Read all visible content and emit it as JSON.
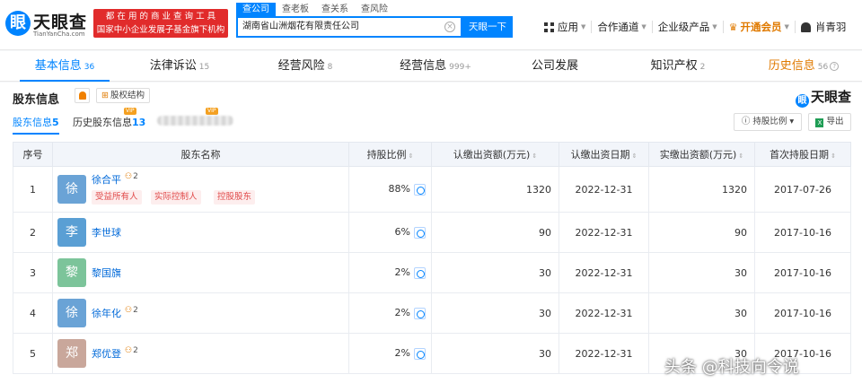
{
  "logo": {
    "brand": "天眼查",
    "domain": "TianYanCha.com",
    "mark": "眼"
  },
  "slogan": {
    "line1": "都 在 用 的 商 业 查 询 工 具",
    "line2": "国家中小企业发展子基金旗下机构"
  },
  "search": {
    "tabs": [
      "查公司",
      "查老板",
      "查关系",
      "查风险"
    ],
    "value": "湖南省山洲烟花有限责任公司",
    "button": "天眼一下"
  },
  "nav": {
    "app": "应用",
    "partner": "合作通道",
    "enterprise": "企业级产品",
    "vip": "开通会员",
    "user": "肖青羽"
  },
  "tabs": [
    {
      "label": "基本信息",
      "count": "36"
    },
    {
      "label": "法律诉讼",
      "count": "15"
    },
    {
      "label": "经营风险",
      "count": "8"
    },
    {
      "label": "经营信息",
      "count": "999+"
    },
    {
      "label": "公司发展",
      "count": ""
    },
    {
      "label": "知识产权",
      "count": "2"
    },
    {
      "label": "历史信息",
      "count": "56"
    }
  ],
  "section": {
    "title": "股东信息",
    "structure_btn": "股权结构",
    "watermark": "天眼查",
    "subtab_current": "股东信息",
    "subtab_current_count": "5",
    "subtab_history": "历史股东信息",
    "subtab_history_count": "13",
    "badge": "VIP",
    "ratio_btn": "持股比例",
    "export_btn": "导出"
  },
  "table": {
    "headers": [
      "序号",
      "股东名称",
      "持股比例",
      "认缴出资额(万元)",
      "认缴出资日期",
      "实缴出资额(万元)",
      "首次持股日期"
    ],
    "rows": [
      {
        "idx": "1",
        "avatar": "徐",
        "color": "#6aa3d6",
        "name": "徐合平",
        "count": "2",
        "ratio": "88%",
        "subscribed": "1320",
        "sub_date": "2022-12-31",
        "paid": "1320",
        "first_date": "2017-07-26",
        "tags": [
          "受益所有人",
          "实际控制人",
          "控股股东"
        ]
      },
      {
        "idx": "2",
        "avatar": "李",
        "color": "#5a9fd4",
        "name": "李世球",
        "count": "",
        "ratio": "6%",
        "subscribed": "90",
        "sub_date": "2022-12-31",
        "paid": "90",
        "first_date": "2017-10-16",
        "tags": []
      },
      {
        "idx": "3",
        "avatar": "黎",
        "color": "#7cc49a",
        "name": "黎国旗",
        "count": "",
        "ratio": "2%",
        "subscribed": "30",
        "sub_date": "2022-12-31",
        "paid": "30",
        "first_date": "2017-10-16",
        "tags": []
      },
      {
        "idx": "4",
        "avatar": "徐",
        "color": "#6aa3d6",
        "name": "徐年化",
        "count": "2",
        "ratio": "2%",
        "subscribed": "30",
        "sub_date": "2022-12-31",
        "paid": "30",
        "first_date": "2017-10-16",
        "tags": []
      },
      {
        "idx": "5",
        "avatar": "郑",
        "color": "#c9a79b",
        "name": "郑优登",
        "count": "2",
        "ratio": "2%",
        "subscribed": "30",
        "sub_date": "2022-12-31",
        "paid": "30",
        "first_date": "2017-10-16",
        "tags": []
      }
    ]
  },
  "source_watermark": "头条 @科技向令说"
}
